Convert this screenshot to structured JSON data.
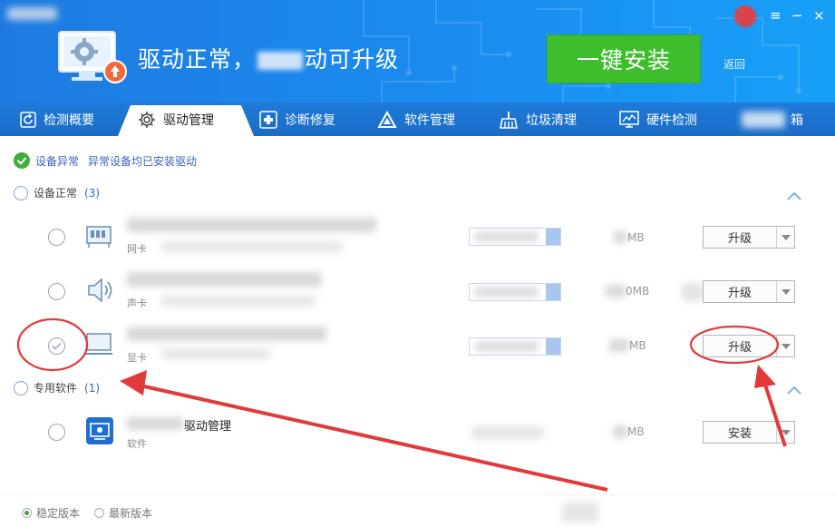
{
  "header": {
    "status_title": "驱动正常，",
    "status_suffix": "动可升级",
    "install_all_label": "一键安装",
    "back_label": "返回",
    "menu_glyph": "≡",
    "minimize_glyph": "−",
    "close_glyph": "×"
  },
  "tabs": [
    {
      "label": "检测概要",
      "icon": "refresh-icon"
    },
    {
      "label": "驱动管理",
      "icon": "gear-icon",
      "active": true
    },
    {
      "label": "诊断修复",
      "icon": "medical-cross-icon"
    },
    {
      "label": "软件管理",
      "icon": "triangle-app-icon"
    },
    {
      "label": "垃圾清理",
      "icon": "broom-icon"
    },
    {
      "label": "硬件检测",
      "icon": "monitor-chart-icon"
    },
    {
      "label": "箱",
      "icon": "toolbox-icon"
    }
  ],
  "banner": {
    "status": "设备异常",
    "message": "异常设备均已安装驱动"
  },
  "sections": {
    "normal": {
      "label": "设备正常",
      "count": "(3)",
      "devices": [
        {
          "type": "网卡",
          "size_suffix": "MB",
          "action": "升级"
        },
        {
          "type": "声卡",
          "size_suffix": "0MB",
          "action": "升级"
        },
        {
          "type": "显卡",
          "size_suffix": "MB",
          "action": "升级"
        }
      ]
    },
    "software": {
      "label": "专用软件",
      "count": "(1)",
      "item": {
        "name_suffix": "驱动管理",
        "type": "软件",
        "size_suffix": "MB",
        "action": "安装"
      }
    }
  },
  "footer": {
    "stable_label": "稳定版本",
    "latest_label": "最新版本"
  },
  "colors": {
    "header_blue": "#1a8cf0",
    "install_green": "#3fbe2d",
    "annotation_red": "#e03a3a",
    "check_green": "#3db03b"
  }
}
